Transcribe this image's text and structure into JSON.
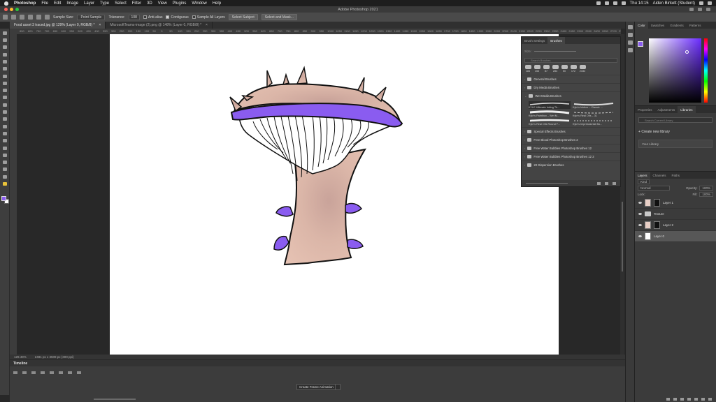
{
  "menubar": {
    "app": "Photoshop",
    "items": [
      "File",
      "Edit",
      "Image",
      "Layer",
      "Type",
      "Select",
      "Filter",
      "3D",
      "View",
      "Plugins",
      "Window",
      "Help"
    ],
    "clock": "Thu 14:15",
    "user": "Aiden Birkett (Student)"
  },
  "window": {
    "title": "Adobe Photoshop 2021"
  },
  "options": {
    "sample_size_label": "Sample Size:",
    "sample_size_value": "Point Sample",
    "tolerance_label": "Tolerance:",
    "tolerance_value": "108",
    "anti_alias": "Anti-alias",
    "contiguous": "Contiguous",
    "sample_all_layers": "Sample All Layers",
    "select_subject": "Select Subject",
    "select_and_mask": "Select and Mask..."
  },
  "tabs": [
    {
      "label": "Food asset 3 traced.jpg @ 129% (Layer 0, RGB/8) *",
      "close": "×"
    },
    {
      "label": "MicrosoftTeams-image (2).png @ 148% (Layer 0, RGB/8) *",
      "close": "×"
    }
  ],
  "ruler": [
    "850",
    "800",
    "750",
    "700",
    "650",
    "600",
    "550",
    "500",
    "450",
    "400",
    "350",
    "300",
    "250",
    "200",
    "150",
    "100",
    "50",
    "0",
    "50",
    "100",
    "150",
    "200",
    "250",
    "300",
    "350",
    "400",
    "450",
    "500",
    "550",
    "600",
    "650",
    "700",
    "750",
    "800",
    "850",
    "900",
    "950",
    "1000",
    "1050",
    "1100",
    "1150",
    "1200",
    "1250",
    "1300",
    "1350",
    "1400",
    "1450",
    "1500",
    "1550",
    "1600",
    "1650",
    "1700",
    "1750",
    "1800",
    "1850",
    "1900",
    "1950",
    "2000",
    "2050",
    "2100",
    "2150",
    "2200",
    "2250",
    "2300",
    "2350",
    "2400",
    "2450",
    "2500",
    "2550",
    "2600",
    "2650",
    "2700",
    "2750"
  ],
  "status": {
    "zoom": "129.49%",
    "doc_info": "2481 px x 3509 px (300 ppi)"
  },
  "timeline": {
    "title": "Timeline",
    "create_button": "Create Frame Animation"
  },
  "brushes": {
    "tabs": [
      "Brush Settings",
      "Brushes"
    ],
    "size_label": "Size:",
    "search_placeholder": "Search Brushes",
    "recents": [
      "184",
      "153",
      "87",
      "284",
      "50",
      "172",
      "2332"
    ],
    "groups_top": [
      "General Brushes",
      "Dry Media Brushes",
      "Wet Media Brushes"
    ],
    "wet_brushes": [
      "KYLE Ultimate Inking Th...",
      "Kyle's Inkbox – Classic ...",
      "Kyle's Paintbox – Wet M...",
      "Kyle's Real Oils – 31",
      "Kyle's Real Oils Round F...",
      "Kyle's Impressionist Bo..."
    ],
    "groups_bottom": [
      "Special Effects Brushes",
      "Free Blood Photoshop Brushes 2",
      "Free Water Bubbles Photoshop Brushes 12",
      "Free Water Bubbles Photoshop Brushes 12 2",
      "20 Dispersion Brushes"
    ]
  },
  "color_panel": {
    "tabs": [
      "Color",
      "Swatches",
      "Gradients",
      "Patterns"
    ],
    "fg": "#8a5cf0",
    "bg": "#ffffff"
  },
  "libraries_panel": {
    "tabs": [
      "Properties",
      "Adjustments",
      "Libraries"
    ],
    "search_placeholder": "Search Current Library",
    "create_label": "Create new library",
    "library_name": "Your Library"
  },
  "layers_panel": {
    "tabs": [
      "Layers",
      "Channels",
      "Paths"
    ],
    "kind_label": "Kind",
    "blend_mode": "Normal",
    "opacity_label": "Opacity:",
    "opacity_value": "100%",
    "lock_label": "Lock:",
    "fill_label": "Fill:",
    "fill_value": "100%",
    "layers": [
      {
        "name": "Layer 1",
        "type": "masked"
      },
      {
        "name": "Texture",
        "type": "group"
      },
      {
        "name": "Layer 2",
        "type": "masked"
      },
      {
        "name": "Layer 0",
        "type": "plain"
      }
    ]
  },
  "artwork": {
    "purple": "#8a5cf0",
    "flesh": "#d9b3a6",
    "outline": "#111111"
  }
}
